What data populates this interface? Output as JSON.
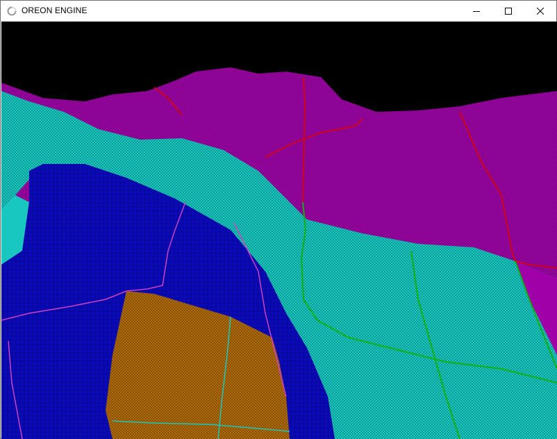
{
  "window": {
    "title": "OREON ENGINE",
    "app_icon": "ring-loader-icon",
    "controls": {
      "minimize_icon": "minimize-icon",
      "maximize_icon": "maximize-icon",
      "close_icon": "close-icon"
    }
  },
  "scene": {
    "description_icon": "terrain-wireframe-render",
    "colors": {
      "sky": "#000000",
      "magenta_layer": "#a000a8",
      "cyan_layer": "#18c8c0",
      "blue_layer": "#0a0ab8",
      "orange_layer": "#b06a08",
      "road_red": "#d00018",
      "road_green": "#10b010",
      "road_pink": "#d040c0"
    }
  }
}
